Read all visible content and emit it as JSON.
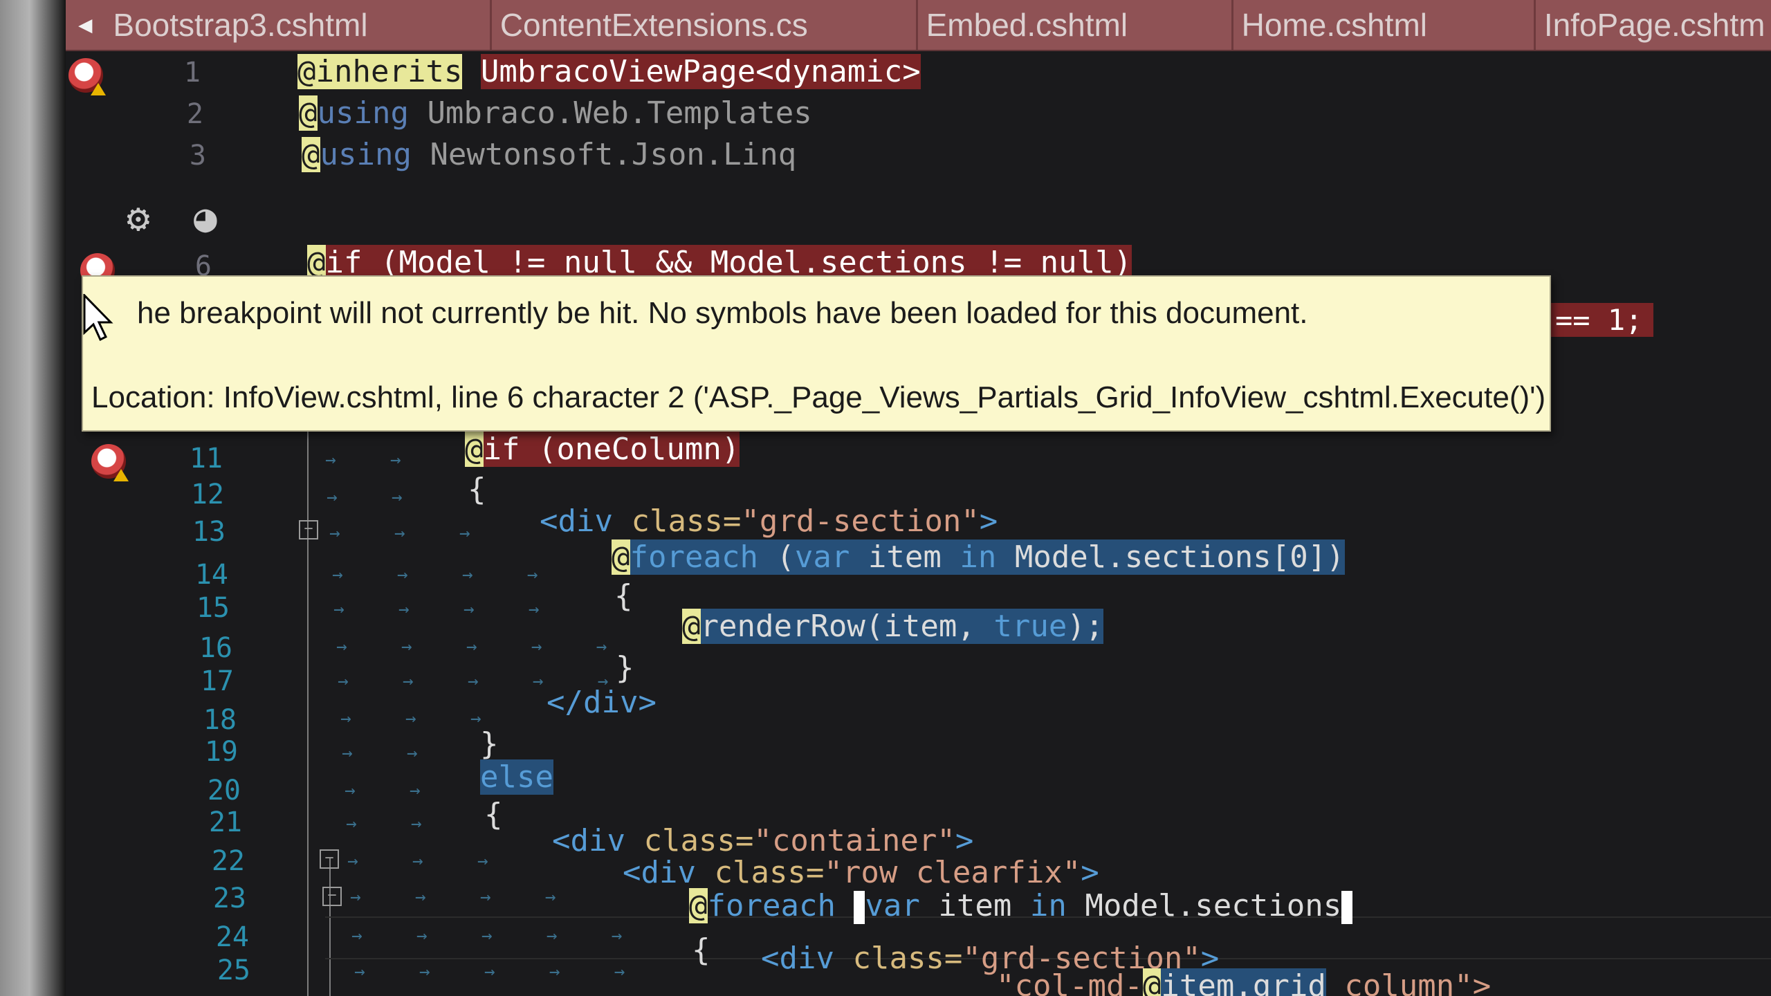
{
  "tabs": [
    {
      "label": "Bootstrap3.cshtml"
    },
    {
      "label": "ContentExtensions.cs"
    },
    {
      "label": "Embed.cshtml"
    },
    {
      "label": "Home.cshtml"
    },
    {
      "label": "InfoPage.cshtm"
    }
  ],
  "line_numbers": {
    "l1": "1",
    "l2": "2",
    "l3": "3",
    "l6": "6",
    "l11": "11",
    "l12": "12",
    "l13": "13",
    "l14": "14",
    "l15": "15",
    "l16": "16",
    "l17": "17",
    "l18": "18",
    "l19": "19",
    "l20": "20",
    "l21": "21",
    "l22": "22",
    "l23": "23",
    "l24": "24",
    "l25": "25"
  },
  "code": {
    "l1_at": "@inherits",
    "l1_rest": "UmbracoViewPage<dynamic>",
    "l2_at": "@",
    "l2_kw": "using",
    "l2_rest": " Umbraco.Web.Templates",
    "l3_at": "@",
    "l3_kw": "using",
    "l3_rest": " Newtonsoft.Json.Linq",
    "l6": "if (Model != null && Model.sections != null)",
    "l6_at": "@",
    "l11_at": "@",
    "l11": "if (oneColumn)",
    "l12": "{",
    "l13_open": "<",
    "l13_tag": "div",
    "l13_attr": " class=",
    "l13_str": "\"grd-section\"",
    "l13_close": ">",
    "l14_at": "@",
    "l14_kw": "foreach",
    "l14_paren": " (",
    "l14_var": "var",
    "l14_mid": " item ",
    "l14_in": "in",
    "l14_rest": " Model.sections[0])",
    "l15": "{",
    "l16_at": "@",
    "l16_fn": "renderRow(item, ",
    "l16_true": "true",
    "l16_end": ");",
    "l17": "}",
    "l18": "</div>",
    "l19": "}",
    "l20": "else",
    "l21": "{",
    "l22_tag": "div",
    "l22_attr": " class=",
    "l22_str": "\"container\"",
    "l23_tag": "div",
    "l23_attr": " class=",
    "l23_str": "\"row clearfix\"",
    "l24_at": "@",
    "l24_kw": "foreach",
    "l24_var": "var",
    "l24_mid": " item ",
    "l24_in": "in",
    "l24_rest": " Model.sections",
    "l25": "{",
    "l26_tag": "div",
    "l26_attr": " class=",
    "l26_str": "\"grd-section\"",
    "l27_partial": "\"col-md-",
    "l27_at": "@",
    "l27_item": "item.grid",
    "l27_rest": " column\">",
    "right_tail": "== 1;"
  },
  "tooltip": {
    "line1": "he breakpoint will not currently be hit. No symbols have been loaded for this document.",
    "line2": "Location: InfoView.cshtml, line 6 character 2 ('ASP._Page_Views_Partials_Grid_InfoView_cshtml.Execute()')"
  },
  "icons": {
    "gear": "gear-icon",
    "bulb": "lightbulb-icon",
    "breakpoint": "breakpoint-warning-icon",
    "scroll_left": "scroll-left-icon"
  }
}
